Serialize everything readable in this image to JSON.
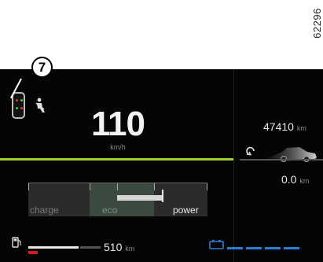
{
  "ref_code": "62296",
  "callout": {
    "number": "7"
  },
  "speed": {
    "value": "110",
    "unit": "km/h"
  },
  "odometer": {
    "value": "47410",
    "unit": "km"
  },
  "trip": {
    "value": "0.0",
    "unit": "km"
  },
  "power_gauge": {
    "labels": {
      "charge": "charge",
      "eco": "eco",
      "power": "power"
    }
  },
  "fuel": {
    "range_value": "510",
    "range_unit": "km"
  },
  "colors": {
    "accent_green": "#9bd22a",
    "warning_red": "#d01e1e",
    "battery_blue": "#2a7fd4"
  },
  "icons": {
    "doors": "car-door-open-icon",
    "seatbelt": "seatbelt-warning-icon",
    "loop": "trip-loop-icon",
    "fuel": "fuel-pump-icon",
    "battery": "battery-icon"
  }
}
